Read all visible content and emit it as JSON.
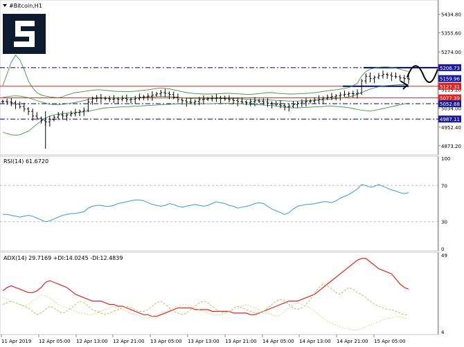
{
  "window": {
    "title": "#Bitcoin,H1"
  },
  "colors": {
    "price_bars": "#000000",
    "bollinger": "#3a9a3a",
    "rsi": "#3399dd",
    "adx": "#dd2222",
    "di_plus": "#b8b84a",
    "di_minus": "#e8c878",
    "resistance": "#000080",
    "support_red": "#cc2222",
    "label_blue": "#1a1a9a",
    "label_red": "#dd2222"
  },
  "chart_data": [
    {
      "type": "candlestick",
      "title": "#Bitcoin,H1",
      "ylim": [
        4840,
        5490
      ],
      "y_ticks": [
        "5434.80",
        "5355.60",
        "5274.00",
        "5113.20",
        "5034.00",
        "4952.40",
        "4873.20"
      ],
      "price_levels": [
        {
          "label": "5206.73",
          "value": 5206.73,
          "style": "blue-dashdot",
          "box": "blue"
        },
        {
          "label": "5159.96",
          "value": 5159.96,
          "style": "none",
          "box": "blue"
        },
        {
          "label": "5127.31",
          "value": 5127.31,
          "style": "red-solid",
          "box": "red"
        },
        {
          "label": "5077.39",
          "value": 5077.39,
          "style": "red-solid",
          "box": "red"
        },
        {
          "label": "5052.68",
          "value": 5052.68,
          "style": "blue-dashdot",
          "box": "blue"
        },
        {
          "label": "4987.11",
          "value": 4987.11,
          "style": "blue-dashdot",
          "box": "blue"
        }
      ],
      "series": [
        {
          "name": "",
          "kind": "close",
          "values": [
            5062,
            5060,
            5058,
            5050,
            5040,
            5030,
            5020,
            5000,
            4990,
            4980,
            4975,
            4985,
            4995,
            5005,
            5000,
            5005,
            5010,
            5015,
            5020,
            5025,
            5060,
            5075,
            5078,
            5076,
            5074,
            5072,
            5073,
            5071,
            5075,
            5070,
            5072,
            5074,
            5080,
            5082,
            5085,
            5090,
            5095,
            5100,
            5097,
            5092,
            5080,
            5070,
            5065,
            5060,
            5058,
            5062,
            5070,
            5072,
            5074,
            5076,
            5078,
            5075,
            5073,
            5070,
            5066,
            5062,
            5060,
            5058,
            5062,
            5065,
            5063,
            5060,
            5055,
            5052,
            5050,
            5045,
            5040,
            5042,
            5048,
            5055,
            5060,
            5062,
            5064,
            5068,
            5072,
            5076,
            5080,
            5083,
            5086,
            5090,
            5093,
            5096,
            5095,
            5098,
            5150,
            5170,
            5160,
            5165,
            5172,
            5178,
            5175,
            5170,
            5168,
            5163,
            5160,
            5158
          ]
        },
        {
          "name": "",
          "kind": "bb_upper",
          "values": [
            5130,
            5180,
            5230,
            5260,
            5240,
            5200,
            5150,
            5120,
            5100,
            5090,
            5085,
            5082,
            5080,
            5078,
            5082,
            5090,
            5095,
            5100,
            5102,
            5105,
            5108,
            5110,
            5112,
            5112,
            5110,
            5108,
            5106,
            5105,
            5104,
            5104,
            5105,
            5106,
            5108,
            5110,
            5112,
            5115,
            5118,
            5120,
            5118,
            5116,
            5112,
            5108,
            5104,
            5100,
            5098,
            5096,
            5095,
            5094,
            5094,
            5094,
            5095,
            5096,
            5097,
            5097,
            5096,
            5095,
            5094,
            5093,
            5093,
            5094,
            5096,
            5098,
            5100,
            5100,
            5098,
            5096,
            5095,
            5094,
            5094,
            5095,
            5096,
            5097,
            5098,
            5100,
            5102,
            5105,
            5108,
            5110,
            5112,
            5115,
            5118,
            5122,
            5130,
            5140,
            5170,
            5190,
            5200,
            5205,
            5208,
            5210,
            5210,
            5208,
            5205,
            5200,
            5195,
            5190
          ]
        },
        {
          "name": "",
          "kind": "bb_mid",
          "values": [
            5080,
            5082,
            5085,
            5086,
            5085,
            5082,
            5078,
            5072,
            5066,
            5060,
            5055,
            5050,
            5048,
            5048,
            5050,
            5052,
            5055,
            5058,
            5062,
            5066,
            5070,
            5073,
            5075,
            5076,
            5076,
            5077,
            5077,
            5077,
            5077,
            5077,
            5078,
            5078,
            5079,
            5080,
            5081,
            5082,
            5083,
            5084,
            5084,
            5083,
            5082,
            5080,
            5078,
            5076,
            5075,
            5074,
            5074,
            5074,
            5074,
            5074,
            5075,
            5075,
            5075,
            5075,
            5075,
            5074,
            5073,
            5072,
            5071,
            5070,
            5070,
            5070,
            5069,
            5068,
            5067,
            5066,
            5065,
            5064,
            5064,
            5064,
            5065,
            5066,
            5067,
            5068,
            5069,
            5070,
            5071,
            5073,
            5075,
            5077,
            5079,
            5082,
            5086,
            5092,
            5100,
            5108,
            5115,
            5120,
            5125,
            5128,
            5130,
            5132,
            5133,
            5134,
            5134,
            5134
          ]
        },
        {
          "name": "",
          "kind": "bb_lower",
          "values": [
            4930,
            4925,
            4920,
            4918,
            4920,
            4928,
            4935,
            4950,
            4965,
            4980,
            4990,
            5000,
            5005,
            5008,
            5010,
            5012,
            5014,
            5015,
            5016,
            5018,
            5020,
            5024,
            5028,
            5032,
            5035,
            5036,
            5037,
            5038,
            5039,
            5040,
            5041,
            5042,
            5043,
            5044,
            5045,
            5046,
            5047,
            5048,
            5049,
            5050,
            5051,
            5052,
            5052,
            5052,
            5052,
            5052,
            5052,
            5052,
            5053,
            5053,
            5054,
            5054,
            5054,
            5054,
            5054,
            5053,
            5052,
            5051,
            5050,
            5049,
            5048,
            5047,
            5046,
            5045,
            5043,
            5040,
            5038,
            5036,
            5035,
            5035,
            5036,
            5037,
            5038,
            5039,
            5040,
            5041,
            5042,
            5042,
            5041,
            5040,
            5038,
            5036,
            5032,
            5028,
            5025,
            5023,
            5022,
            5024,
            5028,
            5032,
            5036,
            5040,
            5044,
            5048,
            5052,
            5055
          ]
        }
      ],
      "projection": [
        5160,
        5200,
        5215,
        5180,
        5150,
        5190,
        5210
      ]
    },
    {
      "type": "line",
      "title": "RSI(14) 61.6720",
      "ylim": [
        0,
        100
      ],
      "y_ticks": [
        "100",
        "70",
        "30",
        "0"
      ],
      "series": [
        {
          "name": "",
          "values": [
            38,
            38,
            37,
            36,
            35,
            36,
            37,
            36,
            34,
            32,
            30,
            31,
            33,
            35,
            37,
            38,
            39,
            39,
            40,
            41,
            45,
            47,
            48,
            48,
            47,
            47,
            48,
            50,
            51,
            52,
            53,
            54,
            54,
            53,
            51,
            49,
            48,
            47,
            48,
            50,
            49,
            47,
            46,
            47,
            48,
            49,
            48,
            47,
            48,
            50,
            52,
            51,
            50,
            48,
            47,
            45,
            46,
            47,
            48,
            50,
            51,
            50,
            47,
            44,
            42,
            40,
            38,
            40,
            44,
            47,
            48,
            49,
            49,
            50,
            51,
            52,
            52,
            51,
            53,
            56,
            58,
            60,
            63,
            66,
            71,
            70,
            68,
            69,
            71,
            69,
            67,
            65,
            64,
            62,
            61,
            62
          ]
        }
      ]
    },
    {
      "type": "line",
      "title": "ADX(14) 29.7169 +DI:14.0245 -DI:12.4839",
      "ylim": [
        4,
        49
      ],
      "y_ticks": [
        "49",
        "4"
      ],
      "series": [
        {
          "name": "ADX(14)",
          "values": [
            28,
            30,
            31,
            30,
            29,
            28,
            27,
            27,
            28,
            30,
            33,
            34,
            33,
            32,
            31,
            30,
            28,
            26,
            25,
            24,
            23,
            22,
            22,
            22,
            21,
            20,
            20,
            19,
            19,
            18,
            17,
            16,
            15,
            14,
            14,
            13,
            13,
            14,
            15,
            16,
            17,
            18,
            18,
            18,
            18,
            17,
            17,
            17,
            17,
            16,
            16,
            16,
            16,
            16,
            15,
            15,
            15,
            15,
            14,
            14,
            15,
            16,
            17,
            18,
            19,
            20,
            21,
            22,
            22,
            22,
            23,
            24,
            25,
            26,
            28,
            30,
            32,
            34,
            36,
            38,
            40,
            42,
            44,
            46,
            47,
            47,
            45,
            43,
            41,
            40,
            39,
            38,
            35,
            32,
            30,
            29
          ]
        },
        {
          "name": "+DI",
          "values": [
            20,
            21,
            22,
            21,
            20,
            19,
            18,
            16,
            14,
            15,
            17,
            19,
            18,
            16,
            15,
            16,
            18,
            20,
            22,
            21,
            19,
            17,
            16,
            15,
            14,
            15,
            16,
            17,
            18,
            19,
            18,
            17,
            16,
            16,
            17,
            19,
            21,
            22,
            20,
            18,
            16,
            15,
            14,
            15,
            17,
            19,
            21,
            22,
            21,
            19,
            17,
            16,
            15,
            16,
            18,
            19,
            18,
            17,
            16,
            15,
            15,
            16,
            18,
            20,
            22,
            23,
            22,
            20,
            18,
            17,
            18,
            20,
            23,
            27,
            30,
            32,
            31,
            29,
            27,
            26,
            28,
            30,
            29,
            27,
            26,
            24,
            22,
            20,
            19,
            18,
            17,
            17,
            16,
            15,
            14,
            14
          ]
        },
        {
          "name": "-DI",
          "values": [
            24,
            23,
            22,
            21,
            20,
            19,
            20,
            22,
            24,
            26,
            25,
            24,
            22,
            20,
            19,
            18,
            17,
            16,
            15,
            15,
            14,
            14,
            15,
            16,
            17,
            18,
            19,
            18,
            17,
            16,
            15,
            14,
            13,
            12,
            12,
            13,
            14,
            15,
            16,
            17,
            18,
            19,
            20,
            20,
            19,
            18,
            17,
            16,
            15,
            14,
            14,
            14,
            15,
            16,
            17,
            18,
            19,
            20,
            19,
            18,
            17,
            16,
            15,
            14,
            13,
            14,
            16,
            18,
            20,
            21,
            20,
            19,
            18,
            16,
            14,
            12,
            10,
            9,
            8,
            7,
            6,
            6,
            5,
            5,
            6,
            7,
            8,
            9,
            10,
            11,
            12,
            12,
            13,
            13,
            12,
            12
          ]
        }
      ]
    }
  ],
  "x_ticks": [
    "11 Apr 2019",
    "12 Apr 05:00",
    "12 Apr 13:00",
    "12 Apr 21:00",
    "13 Apr 05:00",
    "13 Apr 13:00",
    "13 Apr 21:00",
    "14 Apr 05:00",
    "14 Apr 13:00",
    "14 Apr 21:00",
    "15 Apr 05:00"
  ]
}
